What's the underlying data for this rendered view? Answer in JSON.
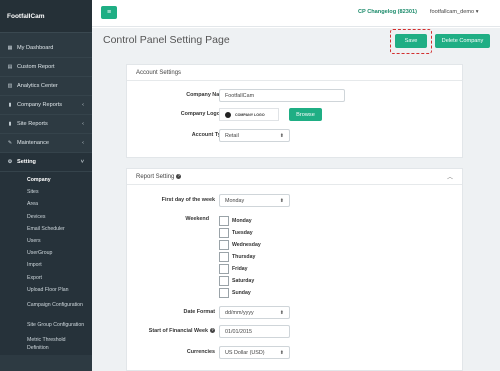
{
  "brand": {
    "name": "FootfallCam"
  },
  "sidebar": {
    "items": [
      {
        "label": "My Dashboard",
        "icon": "dashboard-icon",
        "chevron": ""
      },
      {
        "label": "Custom Report",
        "icon": "report-icon",
        "chevron": ""
      },
      {
        "label": "Analytics Center",
        "icon": "analytics-icon",
        "chevron": ""
      },
      {
        "label": "Company Reports",
        "icon": "chart-icon",
        "chevron": "‹"
      },
      {
        "label": "Site Reports",
        "icon": "chart-icon",
        "chevron": "‹"
      },
      {
        "label": "Maintenance",
        "icon": "wrench-icon",
        "chevron": "‹"
      },
      {
        "label": "Setting",
        "icon": "gear-icon",
        "chevron": "˅"
      }
    ],
    "sub_items": [
      "Company",
      "Sites",
      "Area",
      "Devices",
      "Email Scheduler",
      "Users",
      "UserGroup",
      "Import",
      "Export",
      "Upload Floor Plan",
      "Campaign Configuration",
      "Site Group Configuration",
      "Metric Threshold Definition"
    ]
  },
  "topbar": {
    "changelog": "CP Changelog (82301)",
    "user": "footfallcam_demo ▾"
  },
  "page": {
    "title": "Control Panel Setting Page",
    "save_label": "Save",
    "delete_label": "Delete Company"
  },
  "account_settings": {
    "heading": "Account Settings",
    "company_name_label": "Company Name",
    "company_name_value": "FootfallCam",
    "company_logo_label": "Company Logo",
    "logo_text": "COMPANY LOGO",
    "browse_label": "Browse",
    "account_type_label": "Account Type",
    "account_type_value": "Retail"
  },
  "report_setting": {
    "heading": "Report Setting",
    "first_day_label": "First day of the week",
    "first_day_value": "Monday",
    "weekend_label": "Weekend",
    "days": [
      "Monday",
      "Tuesday",
      "Wednesday",
      "Thursday",
      "Friday",
      "Saturday",
      "Sunday"
    ],
    "date_format_label": "Date Format",
    "date_format_value": "dd/mm/yyyy",
    "fin_week_label": "Start of Financial Week",
    "fin_week_value": "01/01/2015",
    "currencies_label": "Currencies",
    "currencies_value": "US Dollar (USD)"
  },
  "colors": {
    "accent": "#1fae84",
    "sidebar": "#2d3a42",
    "highlight": "#d32f2f"
  }
}
